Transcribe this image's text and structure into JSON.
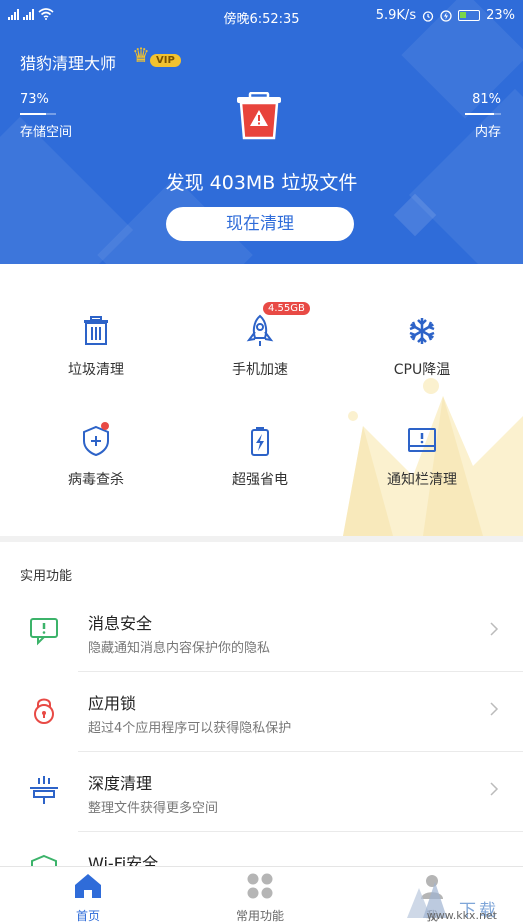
{
  "status_bar": {
    "time": "傍晚6:52:35",
    "speed": "5.9K/s",
    "battery": "23%"
  },
  "header": {
    "app_title": "猎豹清理大师",
    "vip_label": "VIP",
    "storage": {
      "percent": "73%",
      "label": "存储空间",
      "fill": 0.73
    },
    "memory": {
      "percent": "81%",
      "label": "内存",
      "fill": 0.81
    },
    "found_text": "发现 403MB 垃圾文件",
    "clean_button": "现在清理"
  },
  "tools": [
    {
      "label": "垃圾清理",
      "icon": "trash-icon"
    },
    {
      "label": "手机加速",
      "icon": "rocket-icon",
      "badge": "4.55GB"
    },
    {
      "label": "CPU降温",
      "icon": "snowflake-icon"
    },
    {
      "label": "病毒查杀",
      "icon": "shield-plus-icon",
      "dot": true
    },
    {
      "label": "超强省电",
      "icon": "battery-charge-icon"
    },
    {
      "label": "通知栏清理",
      "icon": "notification-bar-icon"
    }
  ],
  "section_title": "实用功能",
  "features": [
    {
      "title": "消息安全",
      "subtitle": "隐藏通知消息内容保护你的隐私",
      "icon": "message-alert-icon",
      "color": "#3cb36a"
    },
    {
      "title": "应用锁",
      "subtitle": "超过4个应用程序可以获得隐私保护",
      "icon": "lock-icon",
      "color": "#e84a45"
    },
    {
      "title": "深度清理",
      "subtitle": "整理文件获得更多空间",
      "icon": "deep-clean-icon",
      "color": "#2f6cd9"
    },
    {
      "title": "Wi-Fi安全",
      "subtitle": "",
      "icon": "wifi-shield-icon",
      "color": "#3cb36a"
    }
  ],
  "tabs": [
    {
      "label": "首页",
      "icon": "home-icon",
      "active": true
    },
    {
      "label": "常用功能",
      "icon": "apps-grid-icon",
      "active": false
    },
    {
      "label": "我",
      "icon": "profile-icon",
      "active": false
    }
  ],
  "watermark": {
    "text": "下载",
    "url": "www.kkx.net"
  },
  "colors": {
    "primary": "#2f6cd9",
    "badge_red": "#e84a45",
    "gold": "#f2c230"
  }
}
